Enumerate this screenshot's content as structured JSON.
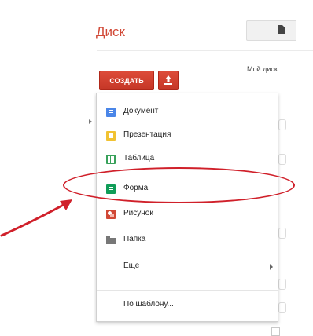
{
  "app": {
    "title": "Диск"
  },
  "header": {
    "breadcrumb": "Мой диск"
  },
  "toolbar": {
    "create_label": "СОЗДАТЬ",
    "upload_icon": "upload-icon"
  },
  "colors": {
    "brand_red": "#d14836",
    "annotation_red": "#d0202a"
  },
  "create_menu": {
    "items": [
      {
        "label": "Документ",
        "icon": "document-icon"
      },
      {
        "label": "Презентация",
        "icon": "presentation-icon"
      },
      {
        "label": "Таблица",
        "icon": "spreadsheet-icon"
      },
      {
        "label": "Форма",
        "icon": "form-icon"
      },
      {
        "label": "Рисунок",
        "icon": "drawing-icon"
      },
      {
        "label": "Папка",
        "icon": "folder-icon"
      },
      {
        "label": "Еще",
        "icon": "submenu-arrow-icon"
      },
      {
        "label": "По шаблону...",
        "icon": ""
      }
    ]
  }
}
